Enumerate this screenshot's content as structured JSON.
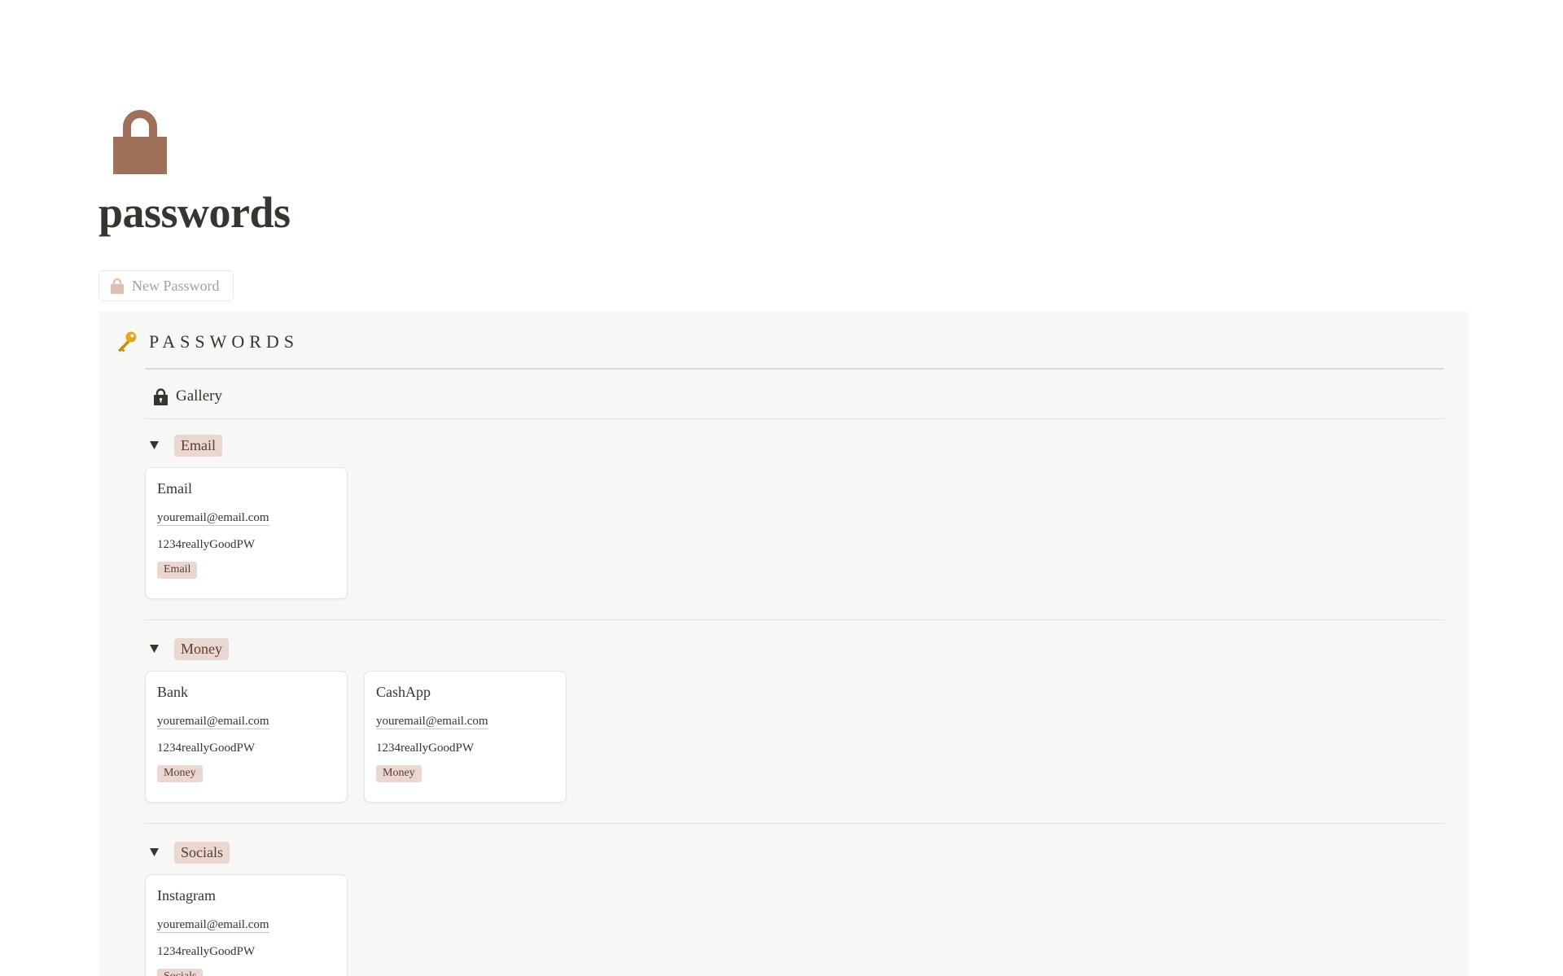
{
  "page": {
    "icon": "lock-icon",
    "title": "passwords",
    "accent_color": "#a0705a"
  },
  "new_button": {
    "icon": "lock-icon",
    "label": "New Password"
  },
  "database": {
    "icon": "key-icon",
    "title": "PASSWORDS",
    "view": {
      "icon": "lock-icon",
      "label": "Gallery"
    },
    "tag_color": "#ead7d1",
    "groups": [
      {
        "label": "Email",
        "cards": [
          {
            "title": "Email",
            "email": "youremail@email.com",
            "password": "1234reallyGoodPW",
            "tag": "Email"
          }
        ]
      },
      {
        "label": "Money",
        "cards": [
          {
            "title": "Bank",
            "email": "youremail@email.com",
            "password": "1234reallyGoodPW",
            "tag": "Money"
          },
          {
            "title": "CashApp",
            "email": "youremail@email.com",
            "password": "1234reallyGoodPW",
            "tag": "Money"
          }
        ]
      },
      {
        "label": "Socials",
        "cards": [
          {
            "title": "Instagram",
            "email": "youremail@email.com",
            "password": "1234reallyGoodPW",
            "tag": "Socials"
          }
        ]
      }
    ]
  }
}
